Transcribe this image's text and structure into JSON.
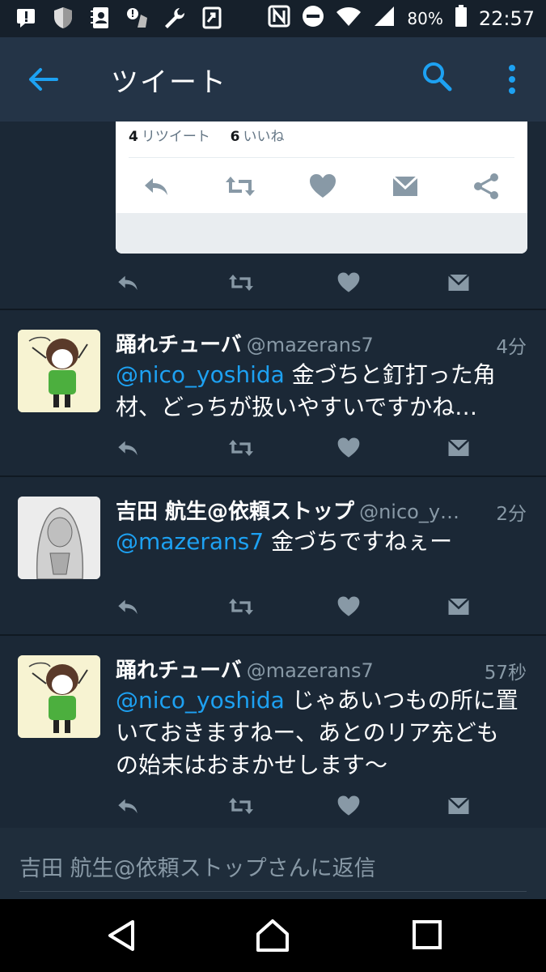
{
  "status_bar": {
    "battery": "80%",
    "time": "22:57"
  },
  "app_bar": {
    "title": "ツイート"
  },
  "embedded": {
    "retweet_count": "4",
    "retweet_label": "リツイート",
    "like_count": "6",
    "like_label": "いいね"
  },
  "tweets": [
    {
      "name": "踊れチューバ",
      "handle": "@mazerans7",
      "time": "4分",
      "mention": "@nico_yoshida",
      "text_line1": " 金づちと釘打った角",
      "text_line2": "材、どっちが扱いやすいですかね…",
      "text_line3": ""
    },
    {
      "name": "吉田 航生@依頼ストップ",
      "handle": "@nico_y…",
      "time": "2分",
      "mention": "@mazerans7",
      "text_line1": " 金づちですねぇー",
      "text_line2": "",
      "text_line3": ""
    },
    {
      "name": "踊れチューバ",
      "handle": "@mazerans7",
      "time": "57秒",
      "mention": "@nico_yoshida",
      "text_line1": " じゃあいつもの所に置",
      "text_line2": "いておきますねー、あとのリア充ども",
      "text_line3": "の始末はおまかせします〜"
    }
  ],
  "reply": {
    "placeholder": "吉田 航生@依頼ストップさんに返信"
  },
  "colors": {
    "background": "#1b2836",
    "appbar": "#243447",
    "accent": "#1da1f2",
    "secondary_text": "#8899a6"
  }
}
